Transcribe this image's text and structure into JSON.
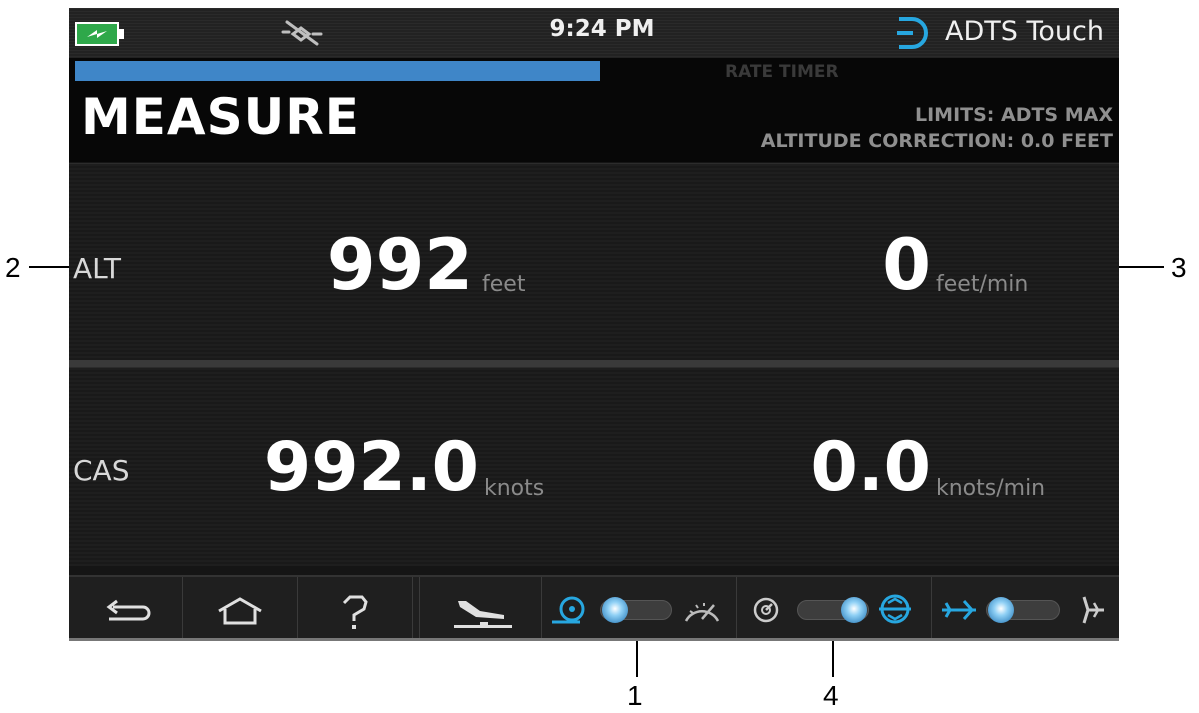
{
  "status_bar": {
    "time": "9:24 PM",
    "brand": "ADTS Touch",
    "icons": [
      "battery-charging-icon",
      "bluetooth-disconnected-icon",
      "brand-logo-icon"
    ]
  },
  "header": {
    "progress_fraction": 0.5,
    "rate_timer": "RATE TIMER",
    "title": "MEASURE",
    "limits": "LIMITS: ADTS MAX",
    "altitude_correction": "ALTITUDE CORRECTION: 0.0 FEET"
  },
  "measurements": [
    {
      "label": "ALT",
      "value": "992",
      "unit": "feet",
      "rate_value": "0",
      "rate_unit": "feet/min"
    },
    {
      "label": "CAS",
      "value": "992.0",
      "unit": "knots",
      "rate_value": "0.0",
      "rate_unit": "knots/min"
    }
  ],
  "toolbar": {
    "buttons": [
      "back-icon",
      "home-icon",
      "help-icon",
      "landing-icon"
    ],
    "toggles": [
      {
        "name": "measure-control-toggle",
        "left_icon": "measure-icon",
        "right_icon": "gauge-icon",
        "state": "left"
      },
      {
        "name": "gauge-attitude-toggle",
        "left_icon": "gauge-dial-icon",
        "right_icon": "attitude-icon",
        "state": "right"
      },
      {
        "name": "aircraft-toggle",
        "left_icon": "aircraft-icon",
        "right_icon": "rotor-icon",
        "state": "left"
      }
    ]
  },
  "callouts": [
    "1",
    "2",
    "3",
    "4"
  ],
  "colors": {
    "accent": "#3f86c8",
    "background": "#151515",
    "text": "#ffffff",
    "muted": "#8a8a8a"
  }
}
